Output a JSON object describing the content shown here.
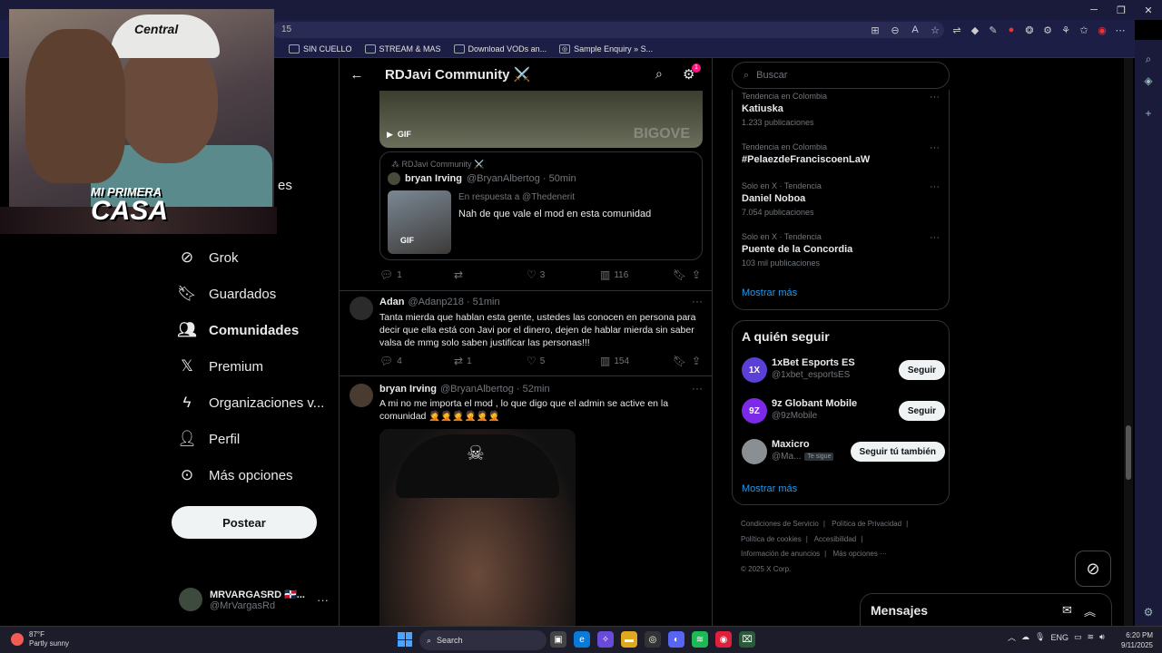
{
  "browser": {
    "url_fragment": "15",
    "bookmarks": [
      {
        "label": "SIN CUELLO"
      },
      {
        "label": "STREAM & MAS"
      },
      {
        "label": "Download VODs an..."
      },
      {
        "label": "Sample Enquiry » S..."
      }
    ]
  },
  "nav": {
    "partial_label": "es",
    "items": [
      {
        "label": "Grok",
        "icon": "grok-icon",
        "bold": false
      },
      {
        "label": "Guardados",
        "icon": "bookmark-icon",
        "bold": false
      },
      {
        "label": "Comunidades",
        "icon": "communities-icon",
        "bold": true
      },
      {
        "label": "Premium",
        "icon": "x-logo-icon",
        "bold": false
      },
      {
        "label": "Organizaciones v...",
        "icon": "lightning-icon",
        "bold": false
      },
      {
        "label": "Perfil",
        "icon": "person-icon",
        "bold": false
      },
      {
        "label": "Más opciones",
        "icon": "more-circle-icon",
        "bold": false
      }
    ],
    "post_label": "Postear",
    "account": {
      "name": "MRVARGASRD 🇩🇴...",
      "handle": "@MrVargasRd"
    }
  },
  "stream_overlay": {
    "cap_text": "Central",
    "logo_line1": "MI PRIMERA",
    "logo_line2": "CASA"
  },
  "header": {
    "title": "RDJavi Community ⚔️",
    "notification_count": "1"
  },
  "feed": {
    "gif_media": {
      "badge": "GIF",
      "watermark": "BIGOVE"
    },
    "first_post_quote": {
      "community": "RDJavi Community ⚔️",
      "name": "bryan Irving",
      "meta": "@BryanAlbertog · 50min",
      "reply_to": "En respuesta a @Thedenerit",
      "thumb_badge": "GIF",
      "text": "Nah de que vale el mod en esta comunidad"
    },
    "first_post_actions": {
      "replies": "1",
      "likes": "3",
      "views": "116"
    },
    "tweets": [
      {
        "name": "Adan",
        "meta": "@Adanp218 · 51min",
        "text": "Tanta mierda que hablan esta gente, ustedes las conocen en persona para decir que ella está con Javi por el dinero, dejen de hablar mierda sin saber valsa de mmg solo saben justificar las personas!!!",
        "replies": "4",
        "reposts": "1",
        "likes": "5",
        "views": "154"
      },
      {
        "name": "bryan Irving",
        "meta": "@BryanAlbertog · 52min",
        "text": "A mi no me importa el mod ,  lo que digo que el admin se active en la comunidad 🤦🤦🤦🤦🤦🤦"
      }
    ]
  },
  "right": {
    "search_placeholder": "Buscar",
    "trends": [
      {
        "context": "Tendencia en Colombia",
        "title": "Katiuska",
        "posts": "1.233 publicaciones"
      },
      {
        "context": "Tendencia en Colombia",
        "title": "#PelaezdeFranciscoenLaW",
        "posts": ""
      },
      {
        "context": "Solo en X · Tendencia",
        "title": "Daniel Noboa",
        "posts": "7.054 publicaciones"
      },
      {
        "context": "Solo en X · Tendencia",
        "title": "Puente de la Concordia",
        "posts": "103 mil publicaciones"
      }
    ],
    "trends_more": "Mostrar más",
    "follow_title": "A quién seguir",
    "follow": [
      {
        "name": "1xBet Esports ES",
        "handle": "@1xbet_esportsES",
        "button": "Seguir",
        "badge": "",
        "avatar_text": "1X",
        "color": "#5b3fd6"
      },
      {
        "name": "9z Globant Mobile",
        "handle": "@9zMobile",
        "button": "Seguir",
        "badge": "",
        "avatar_text": "9Z",
        "color": "#7c2ae8"
      },
      {
        "name": "Maxicro",
        "handle": "@Ma...",
        "button": "Seguir tú también",
        "badge": "Te sigue",
        "avatar_text": "",
        "color": "#8a8f94"
      }
    ],
    "follow_more": "Mostrar más",
    "footer": {
      "terms": "Condiciones de Servicio",
      "privacy": "Política de Privacidad",
      "cookies": "Política de cookies",
      "accessibility": "Accesibilidad",
      "ads": "Información de anuncios",
      "more": "Más opciones ···",
      "copyright": "© 2025 X Corp."
    }
  },
  "messages": {
    "label": "Mensajes"
  },
  "taskbar": {
    "temperature": "87°F",
    "weather": "Partly sunny",
    "search_label": "Search",
    "lang": "ENG",
    "time": "6:20 PM",
    "date": "9/11/2025"
  }
}
